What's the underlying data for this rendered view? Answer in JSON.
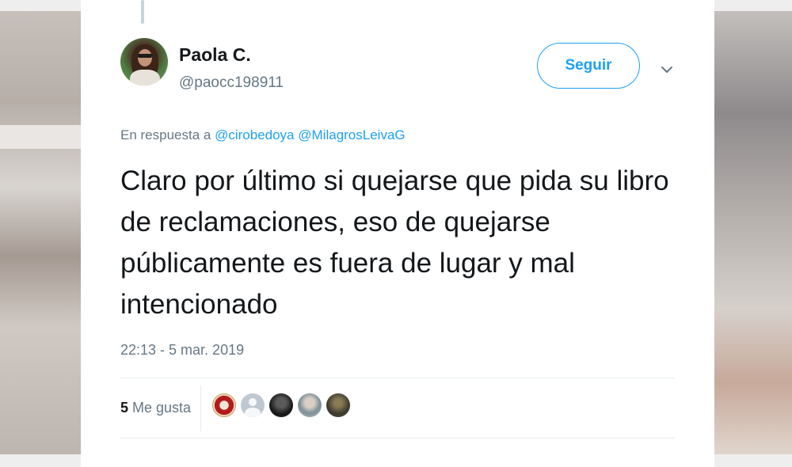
{
  "colors": {
    "accent": "#1da1f2",
    "text_primary": "#14171a",
    "text_secondary": "#657786",
    "divider": "#e6ecf0"
  },
  "tweet": {
    "author_name": "Paola C.",
    "author_handle": "@paocc198911",
    "follow_label": "Seguir",
    "reply_prefix": "En respuesta a",
    "reply_mentions": [
      "@cirobedoya",
      "@MilagrosLeivaG"
    ],
    "text": "Claro por último si quejarse que pida su libro de reclamaciones, eso de quejarse públicamente es fuera de lugar y mal intencionado",
    "timestamp": "22:13 - 5 mar. 2019",
    "likes_count": "5",
    "likes_label": "Me gusta"
  },
  "icons": {
    "more_menu": "chevron-down-icon"
  }
}
